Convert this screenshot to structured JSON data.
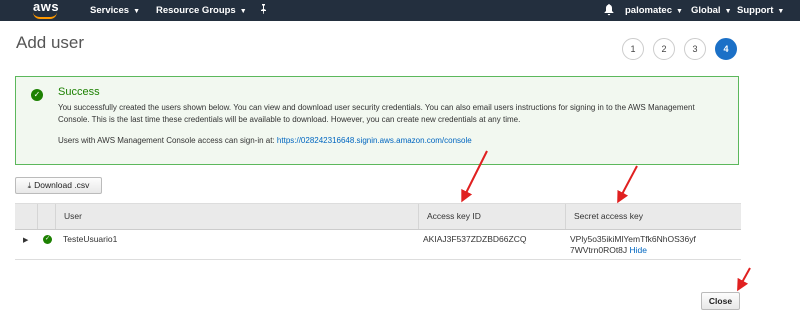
{
  "nav": {
    "logo": "aws",
    "services": "Services",
    "resource_groups": "Resource Groups",
    "user": "palomatec",
    "region": "Global",
    "support": "Support"
  },
  "page": {
    "title": "Add user"
  },
  "steps": [
    "1",
    "2",
    "3",
    "4"
  ],
  "active_step": 4,
  "success": {
    "title": "Success",
    "message": "You successfully created the users shown below. You can view and download user security credentials. You can also email users instructions for signing in to the AWS Management Console. This is the last time these credentials will be available to download. However, you can create new credentials at any time.",
    "console_text": "Users with AWS Management Console access can sign-in at:",
    "console_url": "https://028242316648.signin.aws.amazon.com/console"
  },
  "download_button": "Download .csv",
  "table": {
    "headers": {
      "user": "User",
      "access_key": "Access key ID",
      "secret_key": "Secret access key"
    },
    "rows": [
      {
        "user": "TesteUsuario1",
        "access_key": "AKIAJ3F537ZDZBD66ZCQ",
        "secret_key": "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",
        "hide": "Hide"
      }
    ]
  },
  "close_button": "Close",
  "colors": {
    "nav_bg": "#232f3e",
    "accent": "#ff9900",
    "success": "#1d8102",
    "link": "#0066c0",
    "step_active": "#1b70c7",
    "annotation": "#e02020"
  }
}
